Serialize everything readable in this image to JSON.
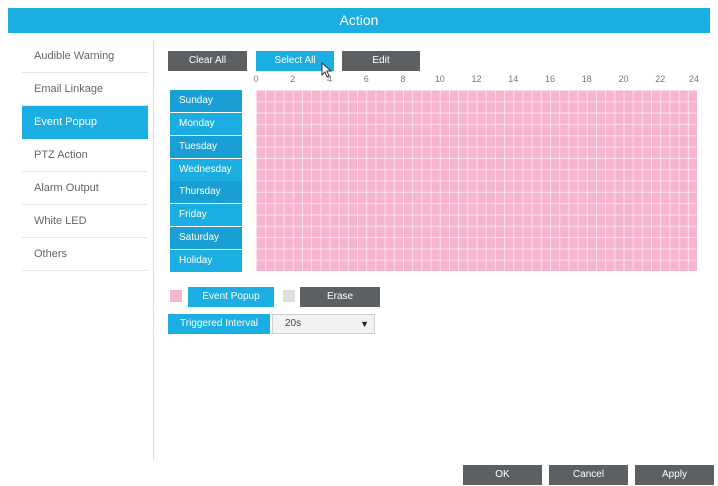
{
  "header": {
    "title": "Action"
  },
  "sidebar": {
    "items": [
      {
        "label": "Audible Warning"
      },
      {
        "label": "Email Linkage"
      },
      {
        "label": "Event Popup"
      },
      {
        "label": "PTZ Action"
      },
      {
        "label": "Alarm Output"
      },
      {
        "label": "White LED"
      },
      {
        "label": "Others"
      }
    ],
    "active_index": 2
  },
  "toolbar": {
    "clear_all": "Clear All",
    "select_all": "Select All",
    "edit": "Edit"
  },
  "schedule": {
    "hours": [
      "0",
      "2",
      "4",
      "6",
      "8",
      "10",
      "12",
      "14",
      "16",
      "18",
      "20",
      "22",
      "24"
    ],
    "days": [
      "Sunday",
      "Monday",
      "Tuesday",
      "Wednesday",
      "Thursday",
      "Friday",
      "Saturday",
      "Holiday"
    ],
    "fill_color": "#f7b4cf",
    "selected_fraction": 1.0
  },
  "legend": {
    "event_popup": "Event Popup",
    "erase": "Erase"
  },
  "triggered_interval": {
    "label": "Triggered Interval",
    "value": "20s"
  },
  "footer": {
    "ok": "OK",
    "cancel": "Cancel",
    "apply": "Apply"
  },
  "colors": {
    "accent": "#1aaee3",
    "dark_button": "#5d6063",
    "schedule_fill": "#f7b4cf"
  }
}
